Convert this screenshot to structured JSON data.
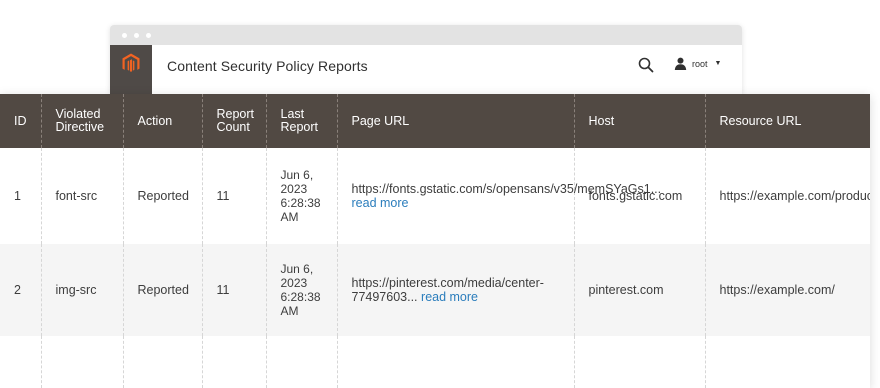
{
  "header": {
    "title": "Content Security Policy Reports",
    "user": "root",
    "logo_icon": "magento-logo-icon",
    "search_icon": "search-icon",
    "user_icon": "user-icon"
  },
  "table": {
    "columns": [
      "ID",
      "Violated Directive",
      "Action",
      "Report Count",
      "Last Report",
      "Page URL",
      "Host",
      "Resource URL"
    ],
    "rows": [
      {
        "id": "1",
        "directive": "font-src",
        "action": "Reported",
        "count": "11",
        "last_report": "Jun 6, 2023 6:28:38 AM",
        "page_url": "https://fonts.gstatic.com/s/opensans/v35/memSYaGs1...",
        "read_more": "read more",
        "host": "fonts.gstatic.com",
        "resource_url": "https://example.com/product.html"
      },
      {
        "id": "2",
        "directive": "img-src",
        "action": "Reported",
        "count": "11",
        "last_report": "Jun 6, 2023 6:28:38 AM",
        "page_url": "https://pinterest.com/media/center-77497603...",
        "read_more": "read more",
        "host": "pinterest.com",
        "resource_url": "https://example.com/"
      }
    ]
  },
  "colors": {
    "header_bg": "#514943",
    "link": "#2b7dbc",
    "logo_orange": "#f26322"
  }
}
